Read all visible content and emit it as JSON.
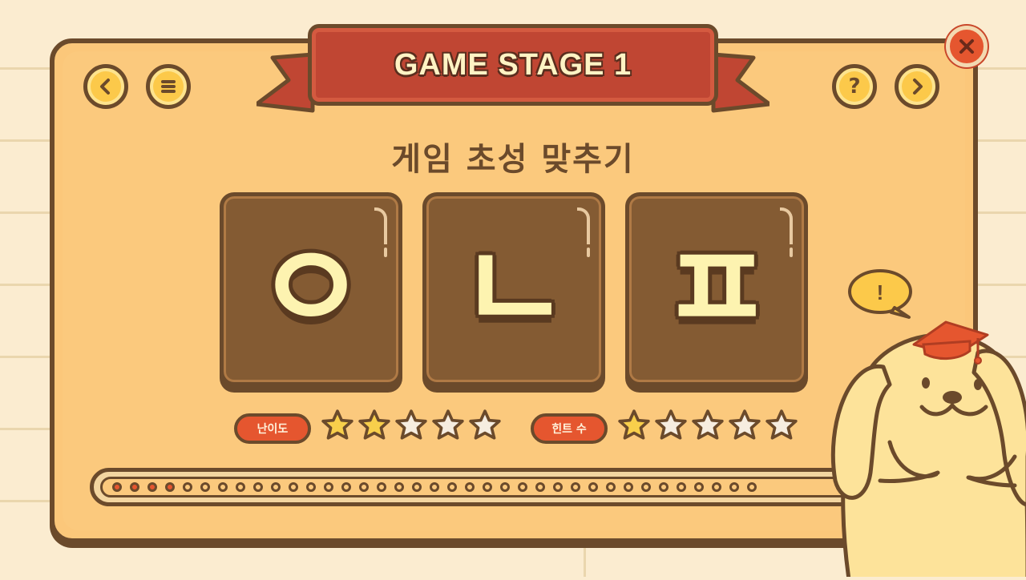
{
  "stage": {
    "title": "GAME STAGE 1"
  },
  "puzzle": {
    "subtitle": "게임 초성 맞추기",
    "tiles": [
      "ㅇ",
      "ㄴ",
      "ㅍ"
    ]
  },
  "buttons": {
    "back_icon": "chevron-left-icon",
    "menu_icon": "menu-icon",
    "help_label": "?",
    "next_icon": "chevron-right-icon",
    "close_icon": "close-icon"
  },
  "difficulty": {
    "label": "난이도",
    "rating": 2,
    "max": 5
  },
  "hints": {
    "label": "힌트 수",
    "count": 1,
    "max": 5
  },
  "progress": {
    "filled": 4,
    "total": 37
  },
  "mascot": {
    "speech": "!"
  },
  "colors": {
    "board": "#fbc77a",
    "outline": "#6b4a2b",
    "banner": "#c04633",
    "tile": "#845b33",
    "accent": "#e5562f",
    "star_on": "#f8cf4b",
    "star_off": "#f6ede0"
  }
}
